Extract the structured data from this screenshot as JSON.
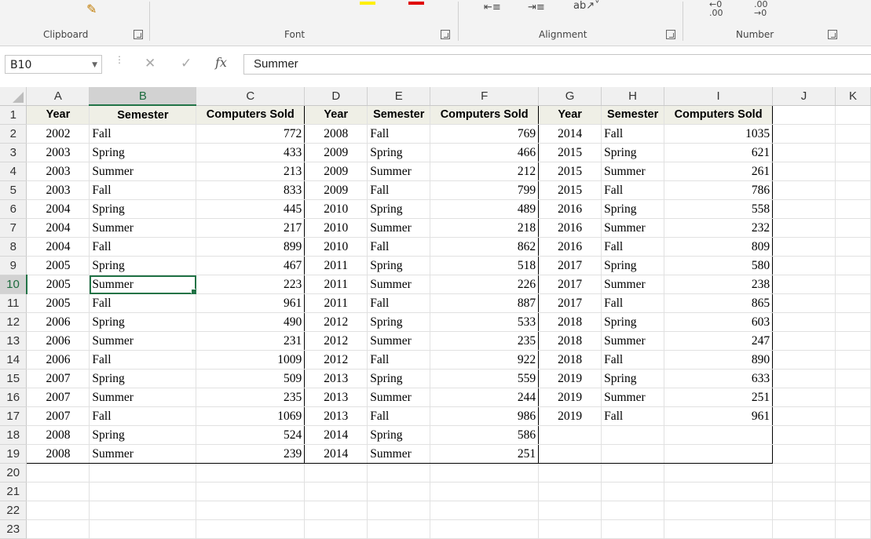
{
  "ribbon": {
    "groups": [
      "Clipboard",
      "Font",
      "Alignment",
      "Number"
    ],
    "icons": [
      "format-painter-icon",
      "highlight-color-icon",
      "font-color-icon",
      "decrease-indent-icon",
      "increase-indent-icon",
      "orientation-icon",
      "increase-decimal-icon",
      "decrease-decimal-icon"
    ],
    "decimal_increase": ".00",
    "decimal_decrease": ".00"
  },
  "formula_bar": {
    "name_box": "B10",
    "fx": "fx",
    "content": "Summer"
  },
  "columns": [
    "A",
    "B",
    "C",
    "D",
    "E",
    "F",
    "G",
    "H",
    "I",
    "J",
    "K"
  ],
  "rows": [
    "1",
    "2",
    "3",
    "4",
    "5",
    "6",
    "7",
    "8",
    "9",
    "10",
    "11",
    "12",
    "13",
    "14",
    "15",
    "16",
    "17",
    "18",
    "19",
    "20",
    "21",
    "22",
    "23"
  ],
  "selected": {
    "col": "B",
    "row": "10"
  },
  "headers": [
    "Year",
    "Semester",
    "Computers Sold",
    "Year",
    "Semester",
    "Computers Sold",
    "Year",
    "Semester",
    "Computers Sold"
  ],
  "data": [
    [
      "2002",
      "Fall",
      "772",
      "2008",
      "Fall",
      "769",
      "2014",
      "Fall",
      "1035"
    ],
    [
      "2003",
      "Spring",
      "433",
      "2009",
      "Spring",
      "466",
      "2015",
      "Spring",
      "621"
    ],
    [
      "2003",
      "Summer",
      "213",
      "2009",
      "Summer",
      "212",
      "2015",
      "Summer",
      "261"
    ],
    [
      "2003",
      "Fall",
      "833",
      "2009",
      "Fall",
      "799",
      "2015",
      "Fall",
      "786"
    ],
    [
      "2004",
      "Spring",
      "445",
      "2010",
      "Spring",
      "489",
      "2016",
      "Spring",
      "558"
    ],
    [
      "2004",
      "Summer",
      "217",
      "2010",
      "Summer",
      "218",
      "2016",
      "Summer",
      "232"
    ],
    [
      "2004",
      "Fall",
      "899",
      "2010",
      "Fall",
      "862",
      "2016",
      "Fall",
      "809"
    ],
    [
      "2005",
      "Spring",
      "467",
      "2011",
      "Spring",
      "518",
      "2017",
      "Spring",
      "580"
    ],
    [
      "2005",
      "Summer",
      "223",
      "2011",
      "Summer",
      "226",
      "2017",
      "Summer",
      "238"
    ],
    [
      "2005",
      "Fall",
      "961",
      "2011",
      "Fall",
      "887",
      "2017",
      "Fall",
      "865"
    ],
    [
      "2006",
      "Spring",
      "490",
      "2012",
      "Spring",
      "533",
      "2018",
      "Spring",
      "603"
    ],
    [
      "2006",
      "Summer",
      "231",
      "2012",
      "Summer",
      "235",
      "2018",
      "Summer",
      "247"
    ],
    [
      "2006",
      "Fall",
      "1009",
      "2012",
      "Fall",
      "922",
      "2018",
      "Fall",
      "890"
    ],
    [
      "2007",
      "Spring",
      "509",
      "2013",
      "Spring",
      "559",
      "2019",
      "Spring",
      "633"
    ],
    [
      "2007",
      "Summer",
      "235",
      "2013",
      "Summer",
      "244",
      "2019",
      "Summer",
      "251"
    ],
    [
      "2007",
      "Fall",
      "1069",
      "2013",
      "Fall",
      "986",
      "2019",
      "Fall",
      "961"
    ],
    [
      "2008",
      "Spring",
      "524",
      "2014",
      "Spring",
      "586",
      "",
      "",
      ""
    ],
    [
      "2008",
      "Summer",
      "239",
      "2014",
      "Summer",
      "251",
      "",
      "",
      ""
    ]
  ]
}
